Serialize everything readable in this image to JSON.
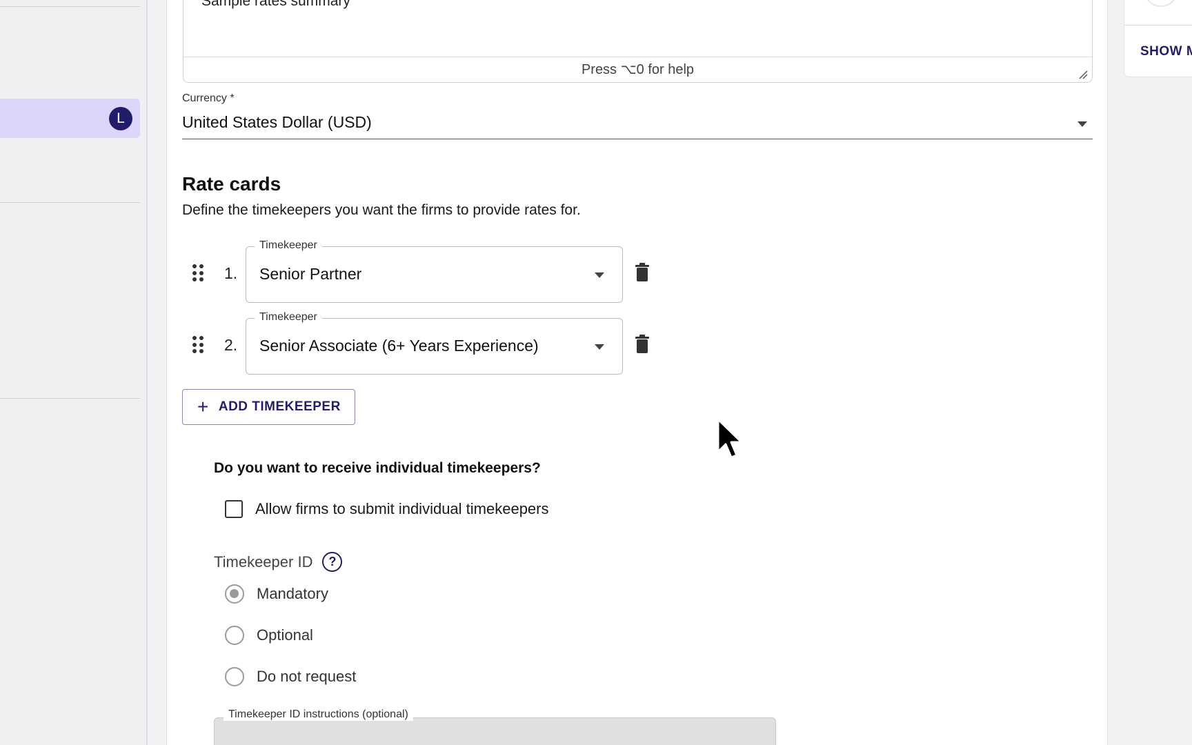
{
  "sidebar": {
    "avatar_initial": "L"
  },
  "summary": {
    "value": "Sample rates summary",
    "help_text": "Press ⌥0 for help"
  },
  "currency": {
    "label": "Currency *",
    "value": "United States Dollar (USD)"
  },
  "rate_cards": {
    "title": "Rate cards",
    "description": "Define the timekeepers you want the firms to provide rates for.",
    "timekeepers": [
      {
        "number": "1.",
        "legend": "Timekeeper",
        "value": "Senior Partner"
      },
      {
        "number": "2.",
        "legend": "Timekeeper",
        "value": "Senior Associate (6+ Years Experience)"
      }
    ],
    "add_button_label": "ADD TIMEKEEPER"
  },
  "individual": {
    "question": "Do you want to receive individual timekeepers?",
    "checkbox_label": "Allow firms to submit individual timekeepers",
    "checkbox_checked": false
  },
  "timekeeper_id": {
    "title": "Timekeeper ID",
    "help_icon": "question-circle-icon",
    "options": [
      {
        "label": "Mandatory",
        "selected": true
      },
      {
        "label": "Optional",
        "selected": false
      },
      {
        "label": "Do not request",
        "selected": false
      }
    ],
    "instructions_label": "Timekeeper ID instructions (optional)"
  },
  "right_panel": {
    "show_more_label": "SHOW M"
  },
  "colors": {
    "accent": "#221d6b",
    "sidebar_active": "#dcd6fb",
    "disabled_field": "#e0e0e0"
  }
}
